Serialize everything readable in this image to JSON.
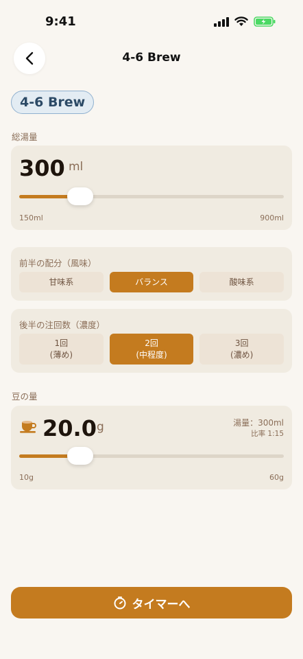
{
  "status": {
    "time": "9:41"
  },
  "nav": {
    "title": "4-6 Brew"
  },
  "recipe_pill": "4-6 Brew",
  "water": {
    "label": "総湯量",
    "value": "300",
    "unit": "ml",
    "min_label": "150ml",
    "max_label": "900ml",
    "slider_fraction": 0.23
  },
  "first_half": {
    "label": "前半の配分（風味）",
    "options": [
      "甘味系",
      "バランス",
      "酸味系"
    ],
    "selected": "バランス"
  },
  "second_half": {
    "label": "後半の注回数（濃度）",
    "options": [
      {
        "line1": "1回",
        "line2": "(薄め)"
      },
      {
        "line1": "2回",
        "line2": "(中程度)"
      },
      {
        "line1": "3回",
        "line2": "(濃め)"
      }
    ],
    "selected_index": 1
  },
  "beans": {
    "label": "豆の量",
    "value": "20.0",
    "unit": "g",
    "water_info": "湯量：300ml",
    "ratio_info": "比率 1:15",
    "min_label": "10g",
    "max_label": "60g",
    "slider_fraction": 0.23
  },
  "timer_button": {
    "label": "タイマーへ"
  },
  "colors": {
    "accent": "#c47b1f",
    "card": "#f0ebe1",
    "background": "#f9f6f1",
    "battery": "#4cd964"
  }
}
